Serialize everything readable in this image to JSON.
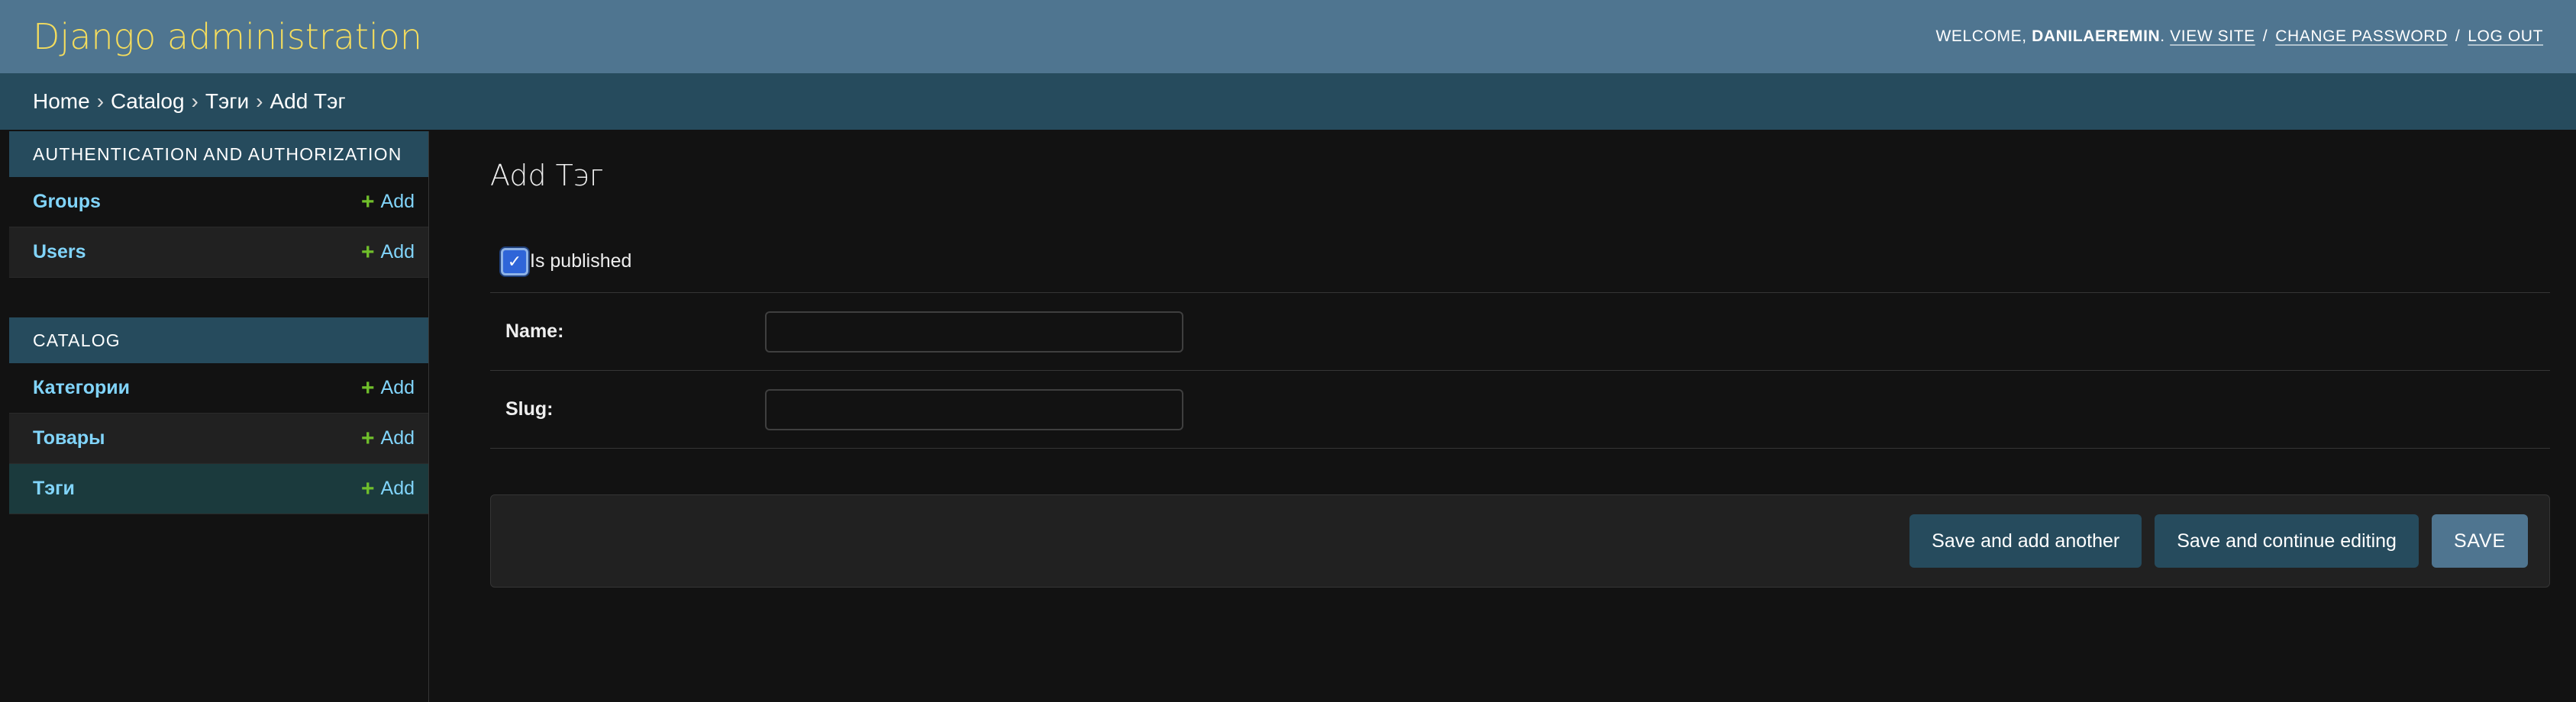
{
  "header": {
    "branding": "Django administration",
    "welcome": "WELCOME,",
    "username": "DANILAEREMIN",
    "username_suffix": ".",
    "view_site": "VIEW SITE",
    "change_password": "CHANGE PASSWORD",
    "log_out": "LOG OUT",
    "separator": "/"
  },
  "breadcrumbs": {
    "home": "Home",
    "app": "Catalog",
    "model": "Тэги",
    "current": "Add Тэг",
    "separator": "›"
  },
  "sidebar": {
    "modules": [
      {
        "caption": "AUTHENTICATION AND AUTHORIZATION",
        "models": [
          {
            "name": "Groups",
            "add": "Add"
          },
          {
            "name": "Users",
            "add": "Add"
          }
        ]
      },
      {
        "caption": "CATALOG",
        "models": [
          {
            "name": "Категории",
            "add": "Add"
          },
          {
            "name": "Товары",
            "add": "Add"
          },
          {
            "name": "Тэги",
            "add": "Add"
          }
        ]
      }
    ]
  },
  "main": {
    "title": "Add Тэг",
    "fields": {
      "is_published": {
        "label": "Is published",
        "checked": true
      },
      "name": {
        "label": "Name:",
        "value": ""
      },
      "slug": {
        "label": "Slug:",
        "value": ""
      }
    },
    "buttons": {
      "save_add_another": "Save and add another",
      "save_continue": "Save and continue editing",
      "save": "SAVE"
    }
  },
  "colors": {
    "header_bg": "#4f7590",
    "breadcrumb_bg": "#264b5d",
    "branding": "#f5dd5d",
    "link": "#81d4fa",
    "add_icon": "#70bf2b",
    "body_bg": "#121212"
  },
  "icons": {
    "add": "plus-icon",
    "checkbox": "check-icon"
  }
}
